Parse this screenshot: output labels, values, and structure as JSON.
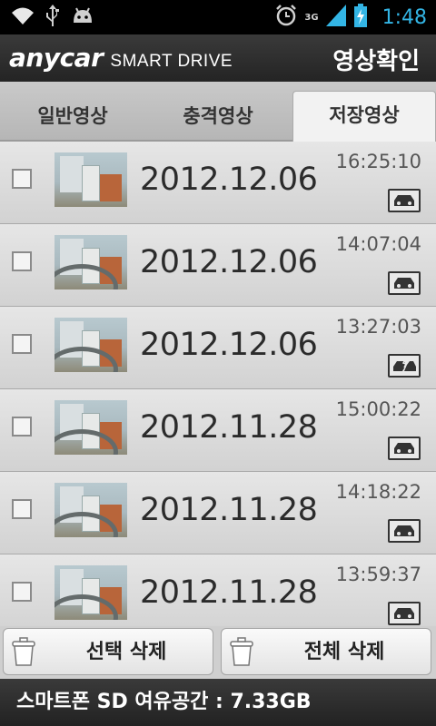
{
  "status_bar": {
    "time": "1:48",
    "network": "3G",
    "icons": [
      "wifi-icon",
      "usb-icon",
      "android-icon",
      "alarm-clock-icon",
      "signal-icon",
      "battery-icon"
    ]
  },
  "app": {
    "brand": "anycar",
    "brand_sub": "SMART DRIVE",
    "title": "영상확인"
  },
  "tabs": [
    {
      "label": "일반영상",
      "selected": false
    },
    {
      "label": "충격영상",
      "selected": false
    },
    {
      "label": "저장영상",
      "selected": true
    }
  ],
  "videos": [
    {
      "date": "2012.12.06",
      "time": "16:25:10",
      "icon": "car-icon",
      "checked": false
    },
    {
      "date": "2012.12.06",
      "time": "14:07:04",
      "icon": "car-icon",
      "checked": false
    },
    {
      "date": "2012.12.06",
      "time": "13:27:03",
      "icon": "car-crash-icon",
      "checked": false
    },
    {
      "date": "2012.11.28",
      "time": "15:00:22",
      "icon": "car-icon",
      "checked": false
    },
    {
      "date": "2012.11.28",
      "time": "14:18:22",
      "icon": "car-icon",
      "checked": false
    },
    {
      "date": "2012.11.28",
      "time": "13:59:37",
      "icon": "car-icon",
      "checked": false
    }
  ],
  "buttons": {
    "delete_selected": "선택 삭제",
    "delete_all": "전체 삭제"
  },
  "storage": {
    "text": "스마트폰 SD 여유공간 : 7.33GB"
  },
  "colors": {
    "status_accent": "#33b5e5",
    "header_bg": "#2e2e2e",
    "list_bg": "#dcdcdc"
  }
}
